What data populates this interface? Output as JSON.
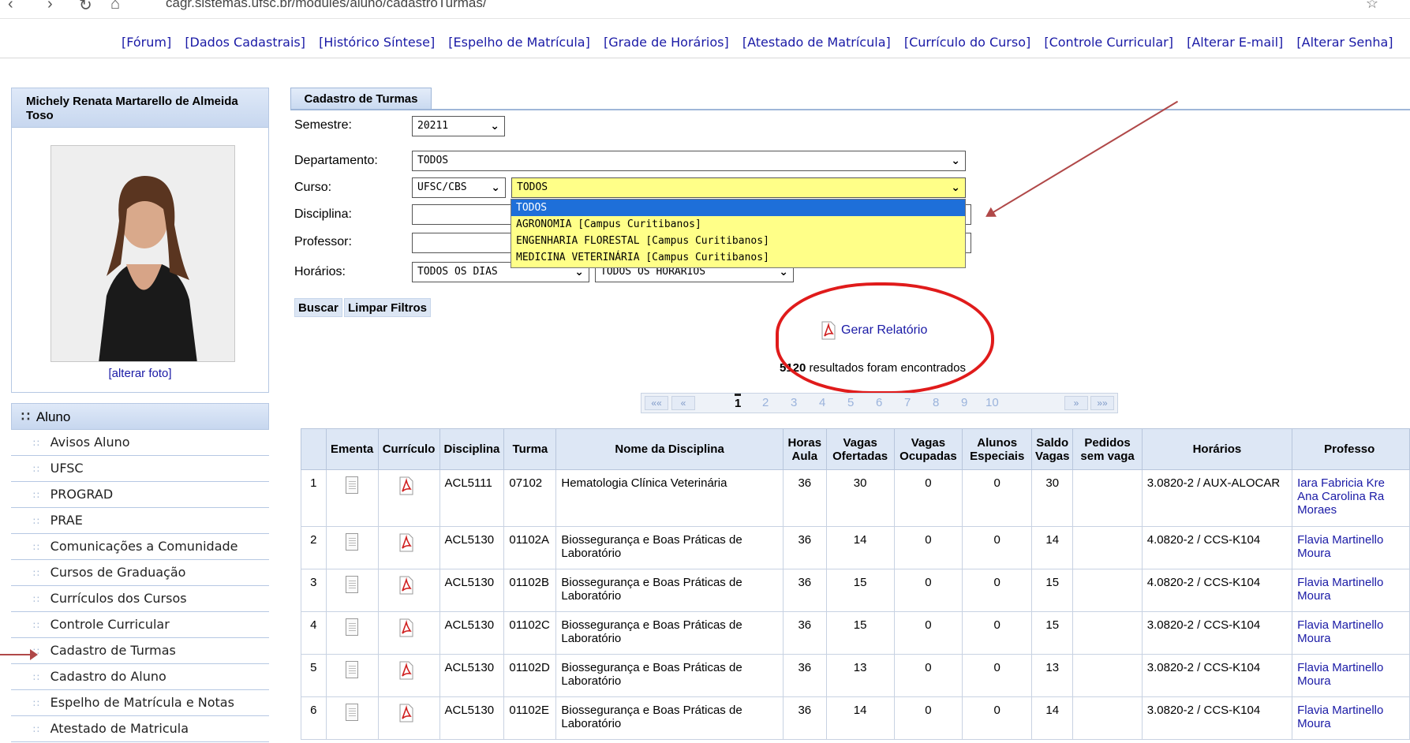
{
  "browser": {
    "url": "cagr.sistemas.ufsc.br/modules/aluno/cadastroTurmas/"
  },
  "top_links": [
    "[Fórum]",
    "[Dados Cadastrais]",
    "[Histórico Síntese]",
    "[Espelho de Matrícula]",
    "[Grade de Horários]",
    "[Atestado de Matrícula]",
    "[Currículo do Curso]",
    "[Controle Curricular]",
    "[Alterar E-mail]",
    "[Alterar Senha]"
  ],
  "profile": {
    "name": "Michely Renata Martarello de Almeida Toso",
    "change_photo": "[alterar foto]"
  },
  "menu": {
    "header": "Aluno",
    "items": [
      "Avisos Aluno",
      "UFSC",
      "PROGRAD",
      "PRAE",
      "Comunicações a Comunidade",
      "Cursos de Graduação",
      "Currículos dos Cursos",
      "Controle Curricular",
      "Cadastro de Turmas",
      "Cadastro do Aluno",
      "Espelho de Matrícula e Notas",
      "Atestado de Matricula"
    ]
  },
  "tab": "Cadastro de Turmas",
  "filters": {
    "semestre_label": "Semestre:",
    "semestre_value": "20211",
    "departamento_label": "Departamento:",
    "departamento_value": "TODOS",
    "curso_label": "Curso:",
    "campus_value": "UFSC/CBS",
    "curso_value": "TODOS",
    "disciplina_label": "Disciplina:",
    "professor_label": "Professor:",
    "horarios_label": "Horários:",
    "dias_value": "TODOS OS DIAS",
    "horarios_value": "TODOS OS HORÁRIOS",
    "curso_options": [
      "TODOS",
      "AGRONOMIA [Campus Curitibanos]",
      "ENGENHARIA FLORESTAL [Campus Curitibanos]",
      "MEDICINA VETERINÁRIA [Campus Curitibanos]"
    ]
  },
  "buttons": {
    "search": "Buscar",
    "clear": "Limpar Filtros"
  },
  "report": {
    "label": "Gerar Relatório",
    "count": "5120",
    "count_suffix": " resultados foram encontrados"
  },
  "pager": {
    "first": "««",
    "prev": "«",
    "pages": [
      "1",
      "2",
      "3",
      "4",
      "5",
      "6",
      "7",
      "8",
      "9",
      "10"
    ],
    "current": "1",
    "next": "»",
    "last": "»»"
  },
  "table": {
    "headers": [
      "",
      "Ementa",
      "Currículo",
      "Disciplina",
      "Turma",
      "Nome da Disciplina",
      "Horas Aula",
      "Vagas Ofertadas",
      "Vagas Ocupadas",
      "Alunos Especiais",
      "Saldo Vagas",
      "Pedidos sem vaga",
      "Horários",
      "Professo"
    ],
    "rows": [
      {
        "n": "1",
        "disciplina": "ACL5111",
        "turma": "07102",
        "nome": "Hematologia Clínica Veterinária",
        "horas": "36",
        "ofertadas": "30",
        "ocupadas": "0",
        "especiais": "0",
        "saldo": "30",
        "pedidos": "",
        "horarios": "3.0820-2 / AUX-ALOCAR",
        "professor": "Iara Fabricia Kre Ana Carolina Ra Moraes"
      },
      {
        "n": "2",
        "disciplina": "ACL5130",
        "turma": "01102A",
        "nome": "Biossegurança e Boas Práticas de Laboratório",
        "horas": "36",
        "ofertadas": "14",
        "ocupadas": "0",
        "especiais": "0",
        "saldo": "14",
        "pedidos": "",
        "horarios": "4.0820-2 / CCS-K104",
        "professor": "Flavia Martinello Moura"
      },
      {
        "n": "3",
        "disciplina": "ACL5130",
        "turma": "01102B",
        "nome": "Biossegurança e Boas Práticas de Laboratório",
        "horas": "36",
        "ofertadas": "15",
        "ocupadas": "0",
        "especiais": "0",
        "saldo": "15",
        "pedidos": "",
        "horarios": "4.0820-2 / CCS-K104",
        "professor": "Flavia Martinello Moura"
      },
      {
        "n": "4",
        "disciplina": "ACL5130",
        "turma": "01102C",
        "nome": "Biossegurança e Boas Práticas de Laboratório",
        "horas": "36",
        "ofertadas": "15",
        "ocupadas": "0",
        "especiais": "0",
        "saldo": "15",
        "pedidos": "",
        "horarios": "3.0820-2 / CCS-K104",
        "professor": "Flavia Martinello Moura"
      },
      {
        "n": "5",
        "disciplina": "ACL5130",
        "turma": "01102D",
        "nome": "Biossegurança e Boas Práticas de Laboratório",
        "horas": "36",
        "ofertadas": "13",
        "ocupadas": "0",
        "especiais": "0",
        "saldo": "13",
        "pedidos": "",
        "horarios": "3.0820-2 / CCS-K104",
        "professor": "Flavia Martinello Moura"
      },
      {
        "n": "6",
        "disciplina": "ACL5130",
        "turma": "01102E",
        "nome": "Biossegurança e Boas Práticas de Laboratório",
        "horas": "36",
        "ofertadas": "14",
        "ocupadas": "0",
        "especiais": "0",
        "saldo": "14",
        "pedidos": "",
        "horarios": "3.0820-2 / CCS-K104",
        "professor": "Flavia Martinello Moura"
      }
    ]
  }
}
